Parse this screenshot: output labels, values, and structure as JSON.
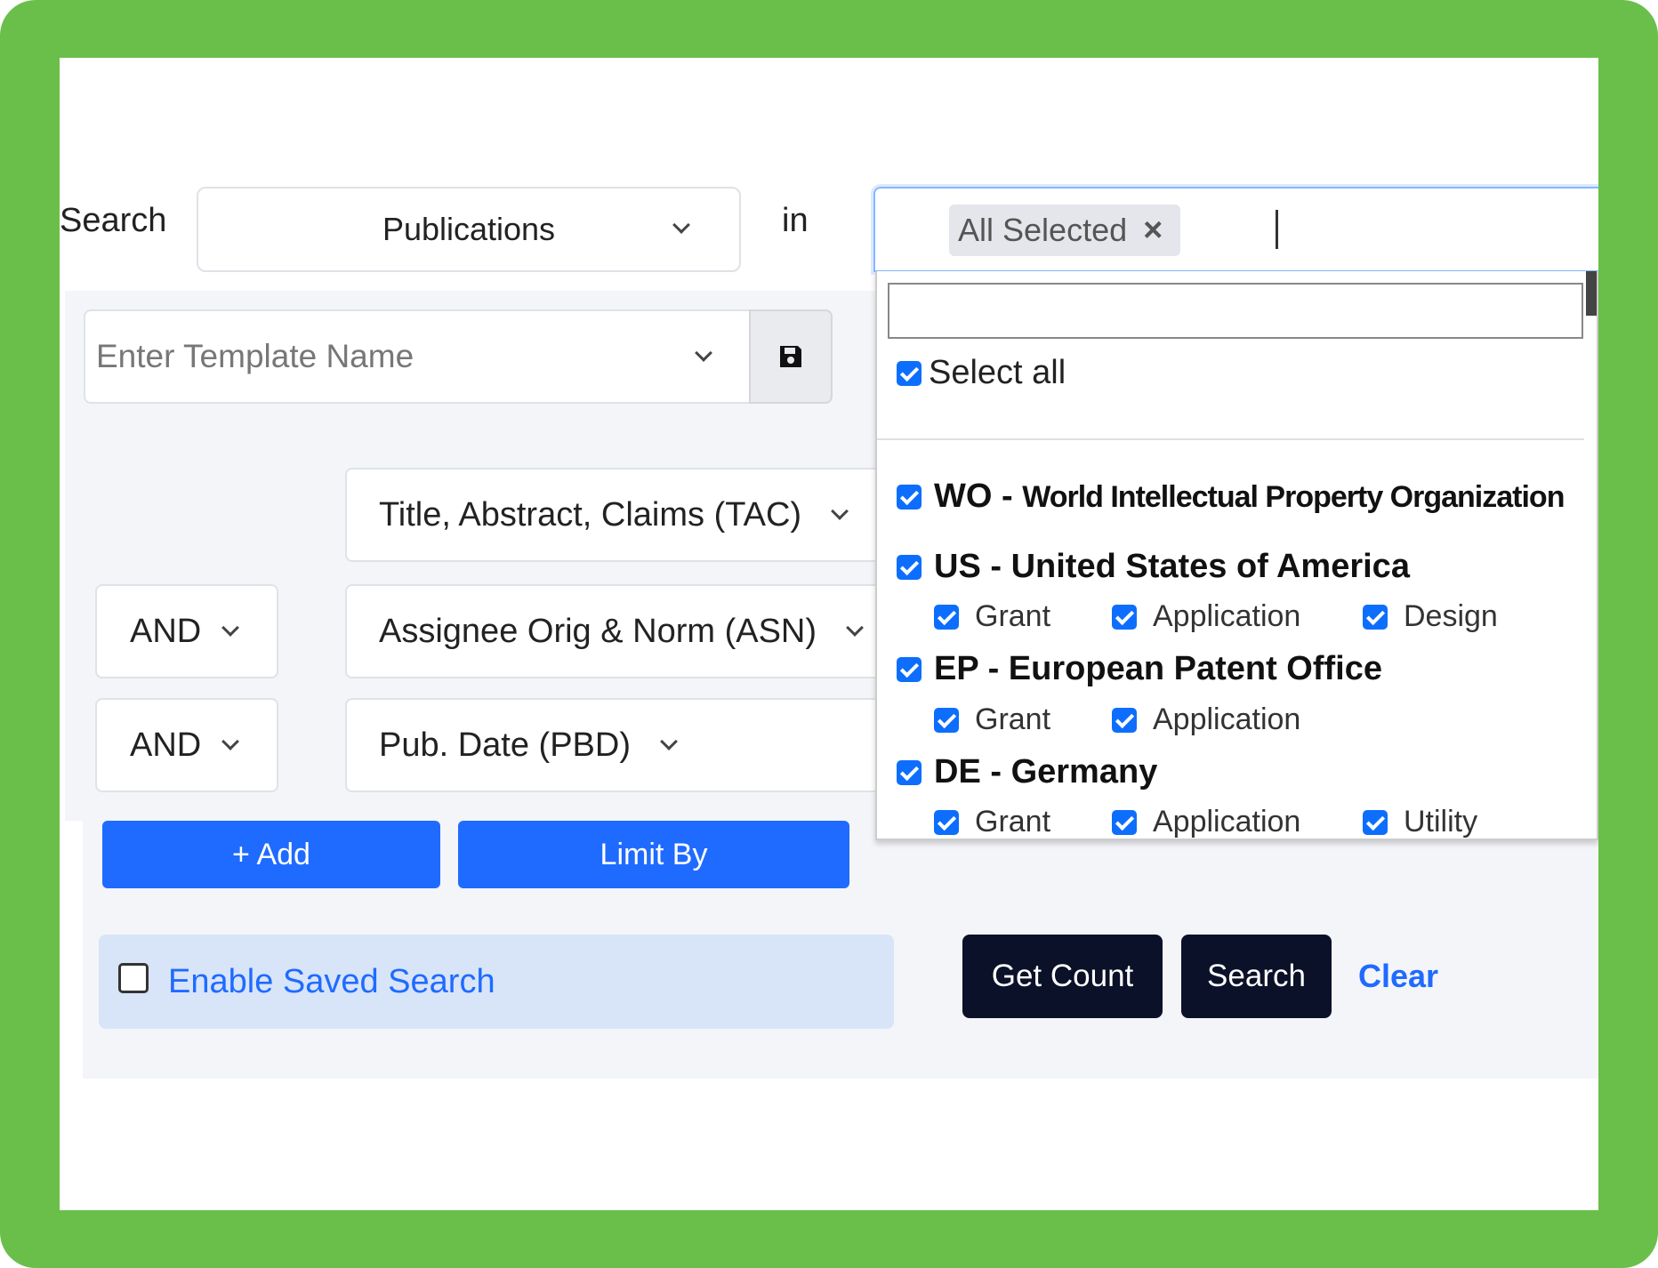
{
  "search_row": {
    "search_label": "Search",
    "type_value": "Publications",
    "in_label": "in",
    "tag_label": "All Selected",
    "tag_remove": "×"
  },
  "template": {
    "placeholder": "Enter Template Name"
  },
  "query_rows": [
    {
      "operator": "",
      "field": "Title, Abstract, Claims (TAC)"
    },
    {
      "operator": "AND",
      "field": "Assignee Orig & Norm (ASN)"
    },
    {
      "operator": "AND",
      "field": "Pub. Date (PBD)"
    }
  ],
  "buttons": {
    "add": "+ Add",
    "limit_by": "Limit By",
    "get_count": "Get Count",
    "search": "Search",
    "clear": "Clear"
  },
  "saved_search": {
    "label": "Enable Saved Search",
    "checked": false
  },
  "dropdown": {
    "search_value": "",
    "select_all": "Select all",
    "countries": [
      {
        "code": "WO",
        "name": "World Intellectual Property Organization",
        "subs": []
      },
      {
        "code": "US",
        "name": "United States of America",
        "subs": [
          "Grant",
          "Application",
          "Design"
        ]
      },
      {
        "code": "EP",
        "name": "European Patent Office",
        "subs": [
          "Grant",
          "Application"
        ]
      },
      {
        "code": "DE",
        "name": "Germany",
        "subs": [
          "Grant",
          "Application",
          "Utility"
        ]
      }
    ]
  },
  "colors": {
    "frame": "#6abf4b",
    "primary": "#1f6bff",
    "dark": "#0a1128",
    "checkbox": "#0d6efd",
    "link": "#1f6bff"
  }
}
